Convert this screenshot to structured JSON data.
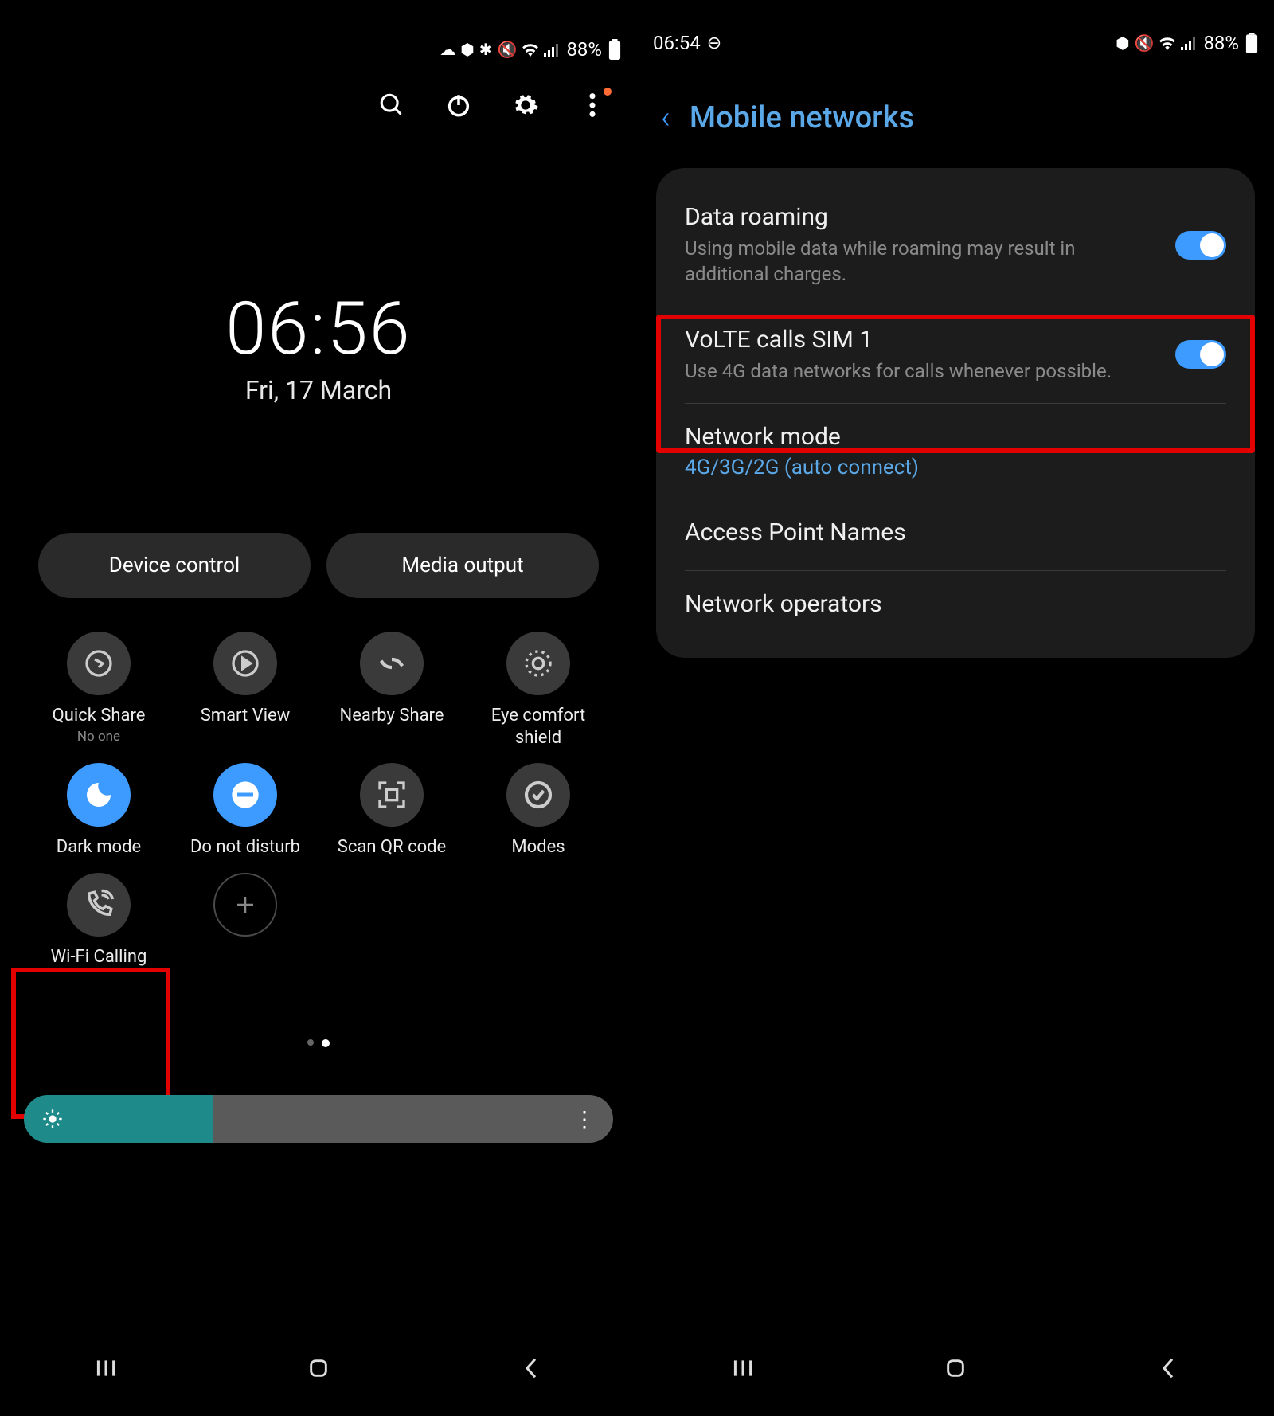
{
  "left": {
    "status": {
      "battery": "88%"
    },
    "clock": {
      "time": "06:56",
      "date": "Fri, 17 March"
    },
    "pills": {
      "device_control": "Device control",
      "media_output": "Media output"
    },
    "tiles": [
      {
        "label": "Quick Share",
        "sub": "No one",
        "icon": "quick-share",
        "active": false
      },
      {
        "label": "Smart View",
        "sub": "",
        "icon": "smart-view",
        "active": false
      },
      {
        "label": "Nearby Share",
        "sub": "",
        "icon": "nearby-share",
        "active": false
      },
      {
        "label": "Eye comfort shield",
        "sub": "",
        "icon": "eye-comfort",
        "active": false
      },
      {
        "label": "Dark mode",
        "sub": "",
        "icon": "dark-mode",
        "active": true
      },
      {
        "label": "Do not disturb",
        "sub": "",
        "icon": "dnd",
        "active": true
      },
      {
        "label": "Scan QR code",
        "sub": "",
        "icon": "qr-code",
        "active": false
      },
      {
        "label": "Modes",
        "sub": "",
        "icon": "modes",
        "active": false
      },
      {
        "label": "Wi-Fi Calling",
        "sub": "",
        "icon": "wifi-calling",
        "active": false
      }
    ]
  },
  "right": {
    "status": {
      "time": "06:54",
      "battery": "88%"
    },
    "title": "Mobile networks",
    "rows": {
      "roaming": {
        "title": "Data roaming",
        "sub": "Using mobile data while roaming may result in additional charges.",
        "on": true
      },
      "volte": {
        "title": "VoLTE calls SIM 1",
        "sub": "Use 4G data networks for calls whenever possible.",
        "on": true
      },
      "network_mode": {
        "title": "Network mode",
        "link": "4G/3G/2G (auto connect)"
      },
      "apn": {
        "title": "Access Point Names"
      },
      "operators": {
        "title": "Network operators"
      }
    }
  }
}
